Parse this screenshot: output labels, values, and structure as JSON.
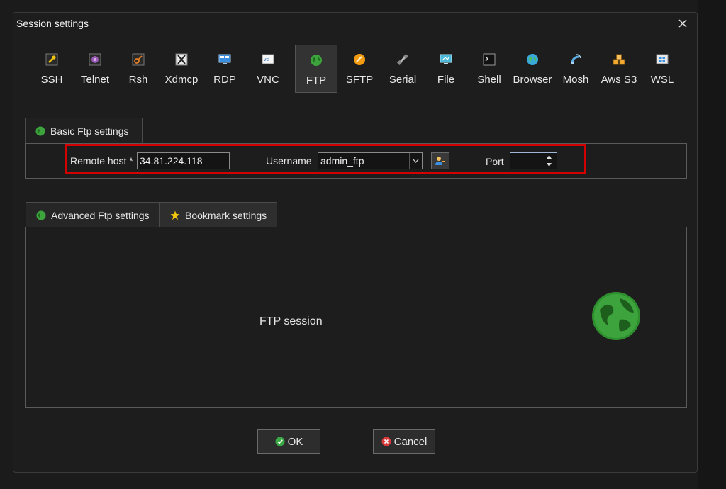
{
  "window": {
    "title": "Session settings"
  },
  "protocols": [
    {
      "label": "SSH",
      "icon": "wrench-key-icon",
      "color": "#f1c40f"
    },
    {
      "label": "Telnet",
      "icon": "telnet-icon",
      "color": "#9b59b6"
    },
    {
      "label": "Rsh",
      "icon": "rsh-icon",
      "color": "#e67e22"
    },
    {
      "label": "Xdmcp",
      "icon": "x-icon",
      "color": "#cccccc"
    },
    {
      "label": "RDP",
      "icon": "rdp-monitor-icon",
      "color": "#3b8fe0"
    },
    {
      "label": "VNC",
      "icon": "vnc-icon",
      "color": "#ffffff"
    },
    {
      "label": "FTP",
      "icon": "globe-icon",
      "color": "#3da43d",
      "selected": true
    },
    {
      "label": "SFTP",
      "icon": "sftp-icon",
      "color": "#f39c12"
    },
    {
      "label": "Serial",
      "icon": "satellite-icon",
      "color": "#bbbbbb"
    },
    {
      "label": "File",
      "icon": "file-monitor-icon",
      "color": "#4ab8d8"
    },
    {
      "label": "Shell",
      "icon": "terminal-icon",
      "color": "#888888"
    },
    {
      "label": "Browser",
      "icon": "earth-icon",
      "color": "#3aa8d8"
    },
    {
      "label": "Mosh",
      "icon": "antenna-icon",
      "color": "#5dade2"
    },
    {
      "label": "Aws S3",
      "icon": "cubes-icon",
      "color": "#f0a830"
    },
    {
      "label": "WSL",
      "icon": "windows-icon",
      "color": "#3b8fe0"
    }
  ],
  "basic_tab": {
    "label": "Basic Ftp settings"
  },
  "fields": {
    "remote_host_label": "Remote host *",
    "remote_host_value": "34.81.224.118",
    "username_label": "Username",
    "username_value": "admin_ftp",
    "port_label": "Port",
    "port_value": ""
  },
  "advanced_tab": {
    "label": "Advanced Ftp settings"
  },
  "bookmark_tab": {
    "label": "Bookmark settings"
  },
  "session": {
    "description": "FTP session"
  },
  "buttons": {
    "ok": "OK",
    "cancel": "Cancel"
  },
  "colors": {
    "highlight": "#d40000",
    "ok_green": "#3aa845",
    "cancel_red": "#d83a3a"
  }
}
